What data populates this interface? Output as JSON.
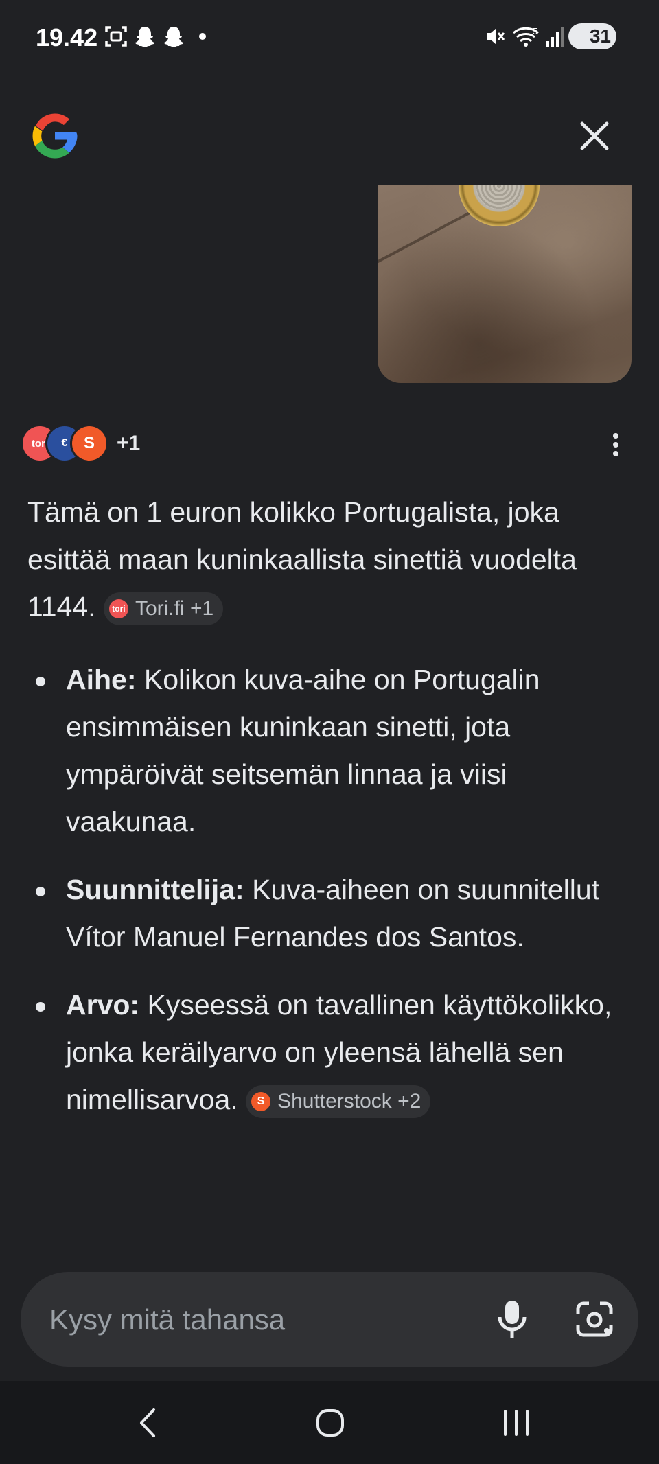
{
  "status": {
    "time": "19.42",
    "battery": "31",
    "network": "5"
  },
  "header": {
    "logo": "google-g-logo",
    "close_icon": "close-icon"
  },
  "sources_row": {
    "icons": [
      {
        "name": "tori",
        "label": "tori",
        "color": "#f05454"
      },
      {
        "name": "euro",
        "label": "€",
        "color": "#2a4f9e"
      },
      {
        "name": "shutterstock",
        "label": "S",
        "color": "#f15a29"
      }
    ],
    "more_count": "+1"
  },
  "answer": {
    "intro": "Tämä on 1 euron kolikko Portugalista, joka esittää maan kuninkaallista sinettiä vuodelta 1144.",
    "intro_chip": {
      "icon_text": "tori",
      "label": "Tori.fi +1"
    },
    "bullets": [
      {
        "title": "Aihe:",
        "text": "Kolikon kuva-aihe on Portugalin ensimmäisen kuninkaan sinetti, jota ympäröivät seitsemän linnaa ja viisi vaakunaa."
      },
      {
        "title": "Suunnittelija:",
        "text": "Kuva-aiheen on suunnitellut Vítor Manuel Fernandes dos Santos."
      },
      {
        "title": "Arvo:",
        "text": "Kyseessä on tavallinen käyttökolikko, jonka keräilyarvo on yleensä lähellä sen nimellisarvoa."
      }
    ],
    "last_chip": {
      "icon_text": "S",
      "label": "Shutterstock +2"
    }
  },
  "ask_bar": {
    "placeholder": "Kysy mitä tahansa"
  },
  "colors": {
    "background": "#202124",
    "surface": "#303134",
    "text": "#e8eaed",
    "nav": "#17181b"
  }
}
